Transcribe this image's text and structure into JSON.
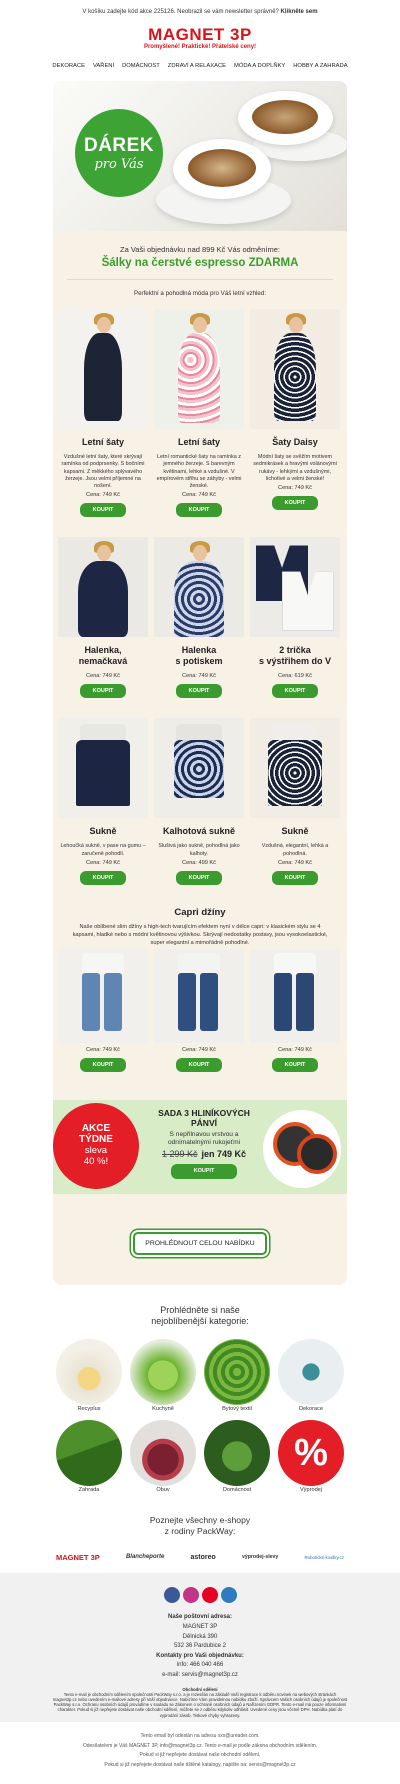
{
  "topbar": {
    "text": "V košíku zadejte kód akce 225126. Neobrazil se vám newsletter správně?",
    "link": "Klikněte sem"
  },
  "logo": {
    "brand": "MAGNET 3P",
    "tagline": "Promyšlené! Praktické! Přátelské ceny!"
  },
  "nav": [
    "DEKORACE",
    "VAŘENÍ",
    "DOMÁCNOST",
    "ZDRAVÍ A RELAXACE",
    "MÓDA A DOPLŇKY",
    "HOBBY A ZAHRADA"
  ],
  "hero": {
    "badge_title": "DÁREK",
    "badge_sub": "pro Vás"
  },
  "gift": {
    "line1": "Za Vaši objednávku nad 899 Kč Vás odměníme:",
    "line2": "Šálky na čerstvé espresso ZDARMA"
  },
  "intro": "Perfektní a pohodlná móda pro Váš letní vzhled:",
  "buy_label": "KOUPIT",
  "products_row1": [
    {
      "name": "Letní šaty",
      "desc": "Vzdušné letní šaty, které skrývají ramínka od podprsenky. S bočními kapsami. Z měkkého splývavého žerzeje. Jsou velmi příjemné na nošení.",
      "price": "Cena: 749 Kč"
    },
    {
      "name": "Letní šaty",
      "desc": "Letní romantické šaty na ramínka z jemného žerzeje. S barevným květinami, lehké a vzdušné. V empírovém střihu se záhyby - velmi ženské.",
      "price": "Cena: 749 Kč"
    },
    {
      "name": "Šaty Daisy",
      "desc": "Módní šaty se svěžím motivem sedmikrásek a hravými volánovými rukávy - lehkými a vzdušnými, lichotivé a velmi ženské!",
      "price": "Cena: 749 Kč"
    }
  ],
  "products_row2": [
    {
      "name1": "Halenka,",
      "name2": "nemačkavá",
      "price": "Cena: 749 Kč"
    },
    {
      "name1": "Halenka",
      "name2": "s potiskem",
      "price": "Cena: 749 Kč"
    },
    {
      "name1": "2 trička",
      "name2": "s výstřihem do V",
      "price": "Cena: 619 Kč"
    }
  ],
  "products_row3": [
    {
      "name": "Sukně",
      "desc": "Lehoučká sukně, v pase na gumu – zaručeně pohodlí.",
      "price": "Cena: 749 Kč"
    },
    {
      "name": "Kalhotová sukně",
      "desc": "Slušivá jako sukně, pohodlná jako kalhoty.",
      "price": "Cena: 499 Kč"
    },
    {
      "name": "Sukně",
      "desc": "Vzdušná, elegantní, lehká a pohodlná.",
      "price": "Cena: 749 Kč"
    }
  ],
  "capri": {
    "title": "Capri džíny",
    "desc": "Naše oblíbené slim džíny s high-tech tvarujícím efektem nyní v délce capri: v klasickém stylu se 4 kapsami, hladké nebo s módní květinovou výšivkou. Skrývají nedostatky postavy, jsou vysokoelastické, super elegantní a mimořádně pohodlné.",
    "prices": [
      "Cena: 749 Kč",
      "Cena: 749 Kč",
      "Cena: 749 Kč"
    ]
  },
  "promo": {
    "star1": "AKCE",
    "star2": "TÝDNE",
    "star3": "sleva",
    "star4": "40 %!",
    "title": "SADA 3 HLINÍKOVÝCH PÁNVÍ",
    "desc": "S nepřilnavou vrstvou a odnímatelnými rukojeťmi",
    "old_price": "1 299 Kč",
    "new_price": "jen 749 Kč"
  },
  "all_button": "PROHLÉDNOUT CELOU NABÍDKU",
  "categories": {
    "title1": "Prohlédněte si naše",
    "title2": "nejoblíbenější kategorie:",
    "items": [
      "Recyplus",
      "Kuchyně",
      "Bytový textil",
      "Dekorace",
      "Zahrada",
      "Obuv",
      "Domácnost",
      "Výprodej"
    ]
  },
  "shops": {
    "title1": "Poznejte všechny e-shopy",
    "title2": "z rodiny PackWay:",
    "items": [
      "MAGNET 3P",
      "Blancheporte",
      "astoreo",
      "výprodej-slevy",
      "Robotické-kosilky.cz"
    ]
  },
  "footer": {
    "addr_title": "Naše poštovní adresa:",
    "addr1": "MAGNET 3P",
    "addr2": "Dělnická 390",
    "addr3": "532 36 Pardubice 2",
    "contact_title": "Kontakty pro Vaši objednávku:",
    "phone": "info: 466 040 466",
    "email": "e-mail: servis@magnet3p.cz",
    "legal_title": "Obchodní sdělení",
    "legal": "Tento e-mail je obchodním sdělením společnosti PackWay s.r.o. a je rozesílán na základě Vaší registrace k odběru novinek na webových stránkách magnet3p.cz nebo uvedením e-mailové adresy při Vaší objednávce. Nabízíme Vám pravidelnou nabídku zboží. Správcem Vašich osobních údajů je společnost PackWay s.r.o. Ochranu osobních údajů provádíme v souladu se Zákonem o ochraně osobních údajů a Nařízením GDPR. Tento e-mail má pouze informativní charakter. Pokud si již nepřejete dostávat naše obchodní sdělení, můžete se z odběru kdykoliv odhlásit. Uvedené ceny jsou včetně DPH. Nabídka platí do vyprodání zásob. Tiskové chyby vyhrazeny.",
    "bottom1": "Tento email byl odeslán na adresu xxx@ureader.com.",
    "bottom2": "Odesílatelem je Váš MAGNET 3P, info@magnet3p.cz. Tento e-mail je podle zákona obchodním sdělením.",
    "bottom3": "Pokud si již nepřejete dostávat naše obchodní sdělení,",
    "bottom4": "Pokud si již nepřejete dostávat naše tištěné katalogy, napište na: servis@magnet3p.cz"
  },
  "colors": {
    "brand_red": "#d7141a",
    "accent_green": "#3c9b2f",
    "panel_bg": "#f7f1e6"
  }
}
